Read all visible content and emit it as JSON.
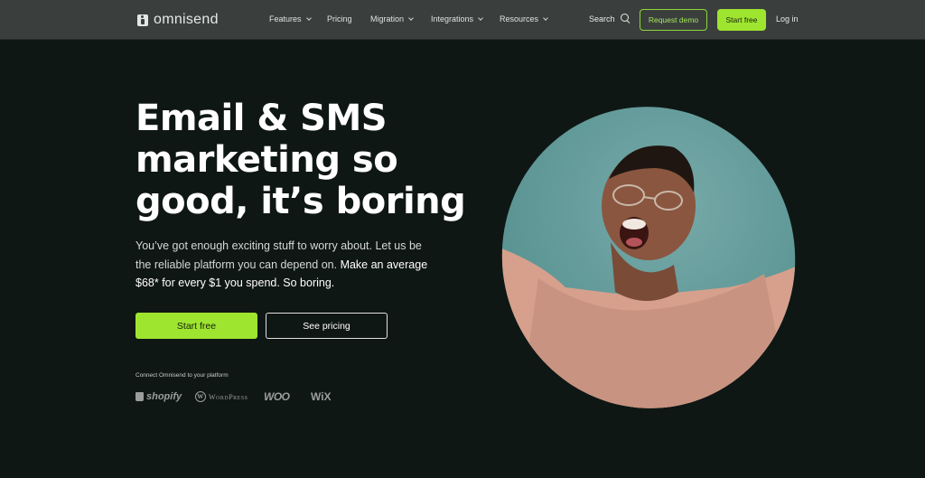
{
  "brand": {
    "name": "omnisend"
  },
  "nav": {
    "items": [
      {
        "label": "Features",
        "has_dropdown": true
      },
      {
        "label": "Pricing",
        "has_dropdown": false
      },
      {
        "label": "Migration",
        "has_dropdown": true
      },
      {
        "label": "Integrations",
        "has_dropdown": true
      },
      {
        "label": "Resources",
        "has_dropdown": true
      }
    ],
    "search_label": "Search",
    "request_demo_label": "Request demo",
    "start_free_label": "Start free",
    "login_label": "Log in"
  },
  "hero": {
    "headline_lines": [
      "Email & SMS",
      "marketing so",
      "good, it’s boring"
    ],
    "subtext_plain": "You’ve got enough exciting stuff to worry about. Let us be the reliable platform you can depend on.",
    "subtext_emphasis": "Make an average $68* for every $1 you spend. So boring.",
    "primary_cta": "Start free",
    "secondary_cta": "See pricing",
    "connect_label": "Connect Omnisend to your platform",
    "platforms": [
      "shopify",
      "WordPress",
      "WOO",
      "WiX"
    ]
  },
  "colors": {
    "background": "#0f1714",
    "nav_background": "#3a3f3d",
    "accent_green": "#9ee52f",
    "photo_background": "#5e9796"
  },
  "icons": [
    "search-icon",
    "chevron-down-icon",
    "omnisend-logo-icon",
    "shopify-bag-icon",
    "wordpress-icon"
  ]
}
